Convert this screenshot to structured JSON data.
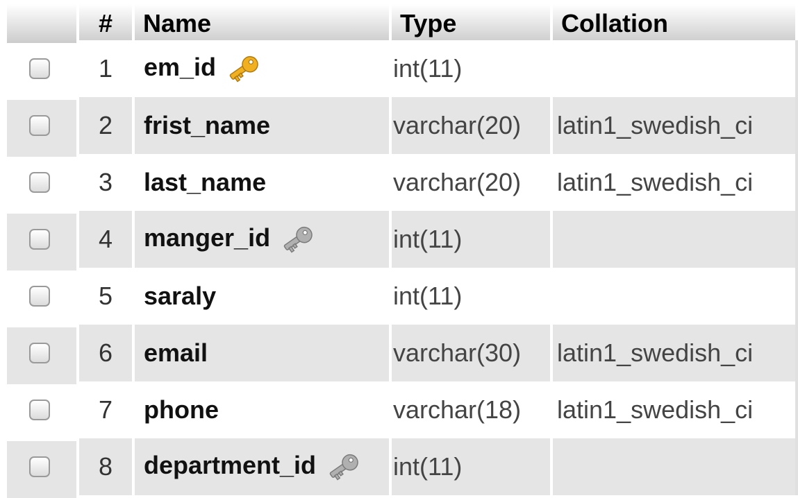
{
  "header": {
    "num": "#",
    "name": "Name",
    "type": "Type",
    "collation": "Collation"
  },
  "rows": [
    {
      "num": "1",
      "name": "em_id",
      "type": "int(11)",
      "collation": "",
      "key": "primary"
    },
    {
      "num": "2",
      "name": "frist_name",
      "type": "varchar(20)",
      "collation": "latin1_swedish_ci",
      "key": "none"
    },
    {
      "num": "3",
      "name": "last_name",
      "type": "varchar(20)",
      "collation": "latin1_swedish_ci",
      "key": "none"
    },
    {
      "num": "4",
      "name": "manger_id",
      "type": "int(11)",
      "collation": "",
      "key": "index"
    },
    {
      "num": "5",
      "name": "saraly",
      "type": "int(11)",
      "collation": "",
      "key": "none"
    },
    {
      "num": "6",
      "name": "email",
      "type": "varchar(30)",
      "collation": "latin1_swedish_ci",
      "key": "none"
    },
    {
      "num": "7",
      "name": "phone",
      "type": "varchar(18)",
      "collation": "latin1_swedish_ci",
      "key": "none"
    },
    {
      "num": "8",
      "name": "department_id",
      "type": "int(11)",
      "collation": "",
      "key": "index"
    }
  ],
  "icons": {
    "primary_key": "key-gold-icon",
    "index_key": "key-gray-icon"
  },
  "colors": {
    "row_alt": "#e5e5e5",
    "primary_key": "#f0b020",
    "index_key": "#b0b0b0"
  }
}
